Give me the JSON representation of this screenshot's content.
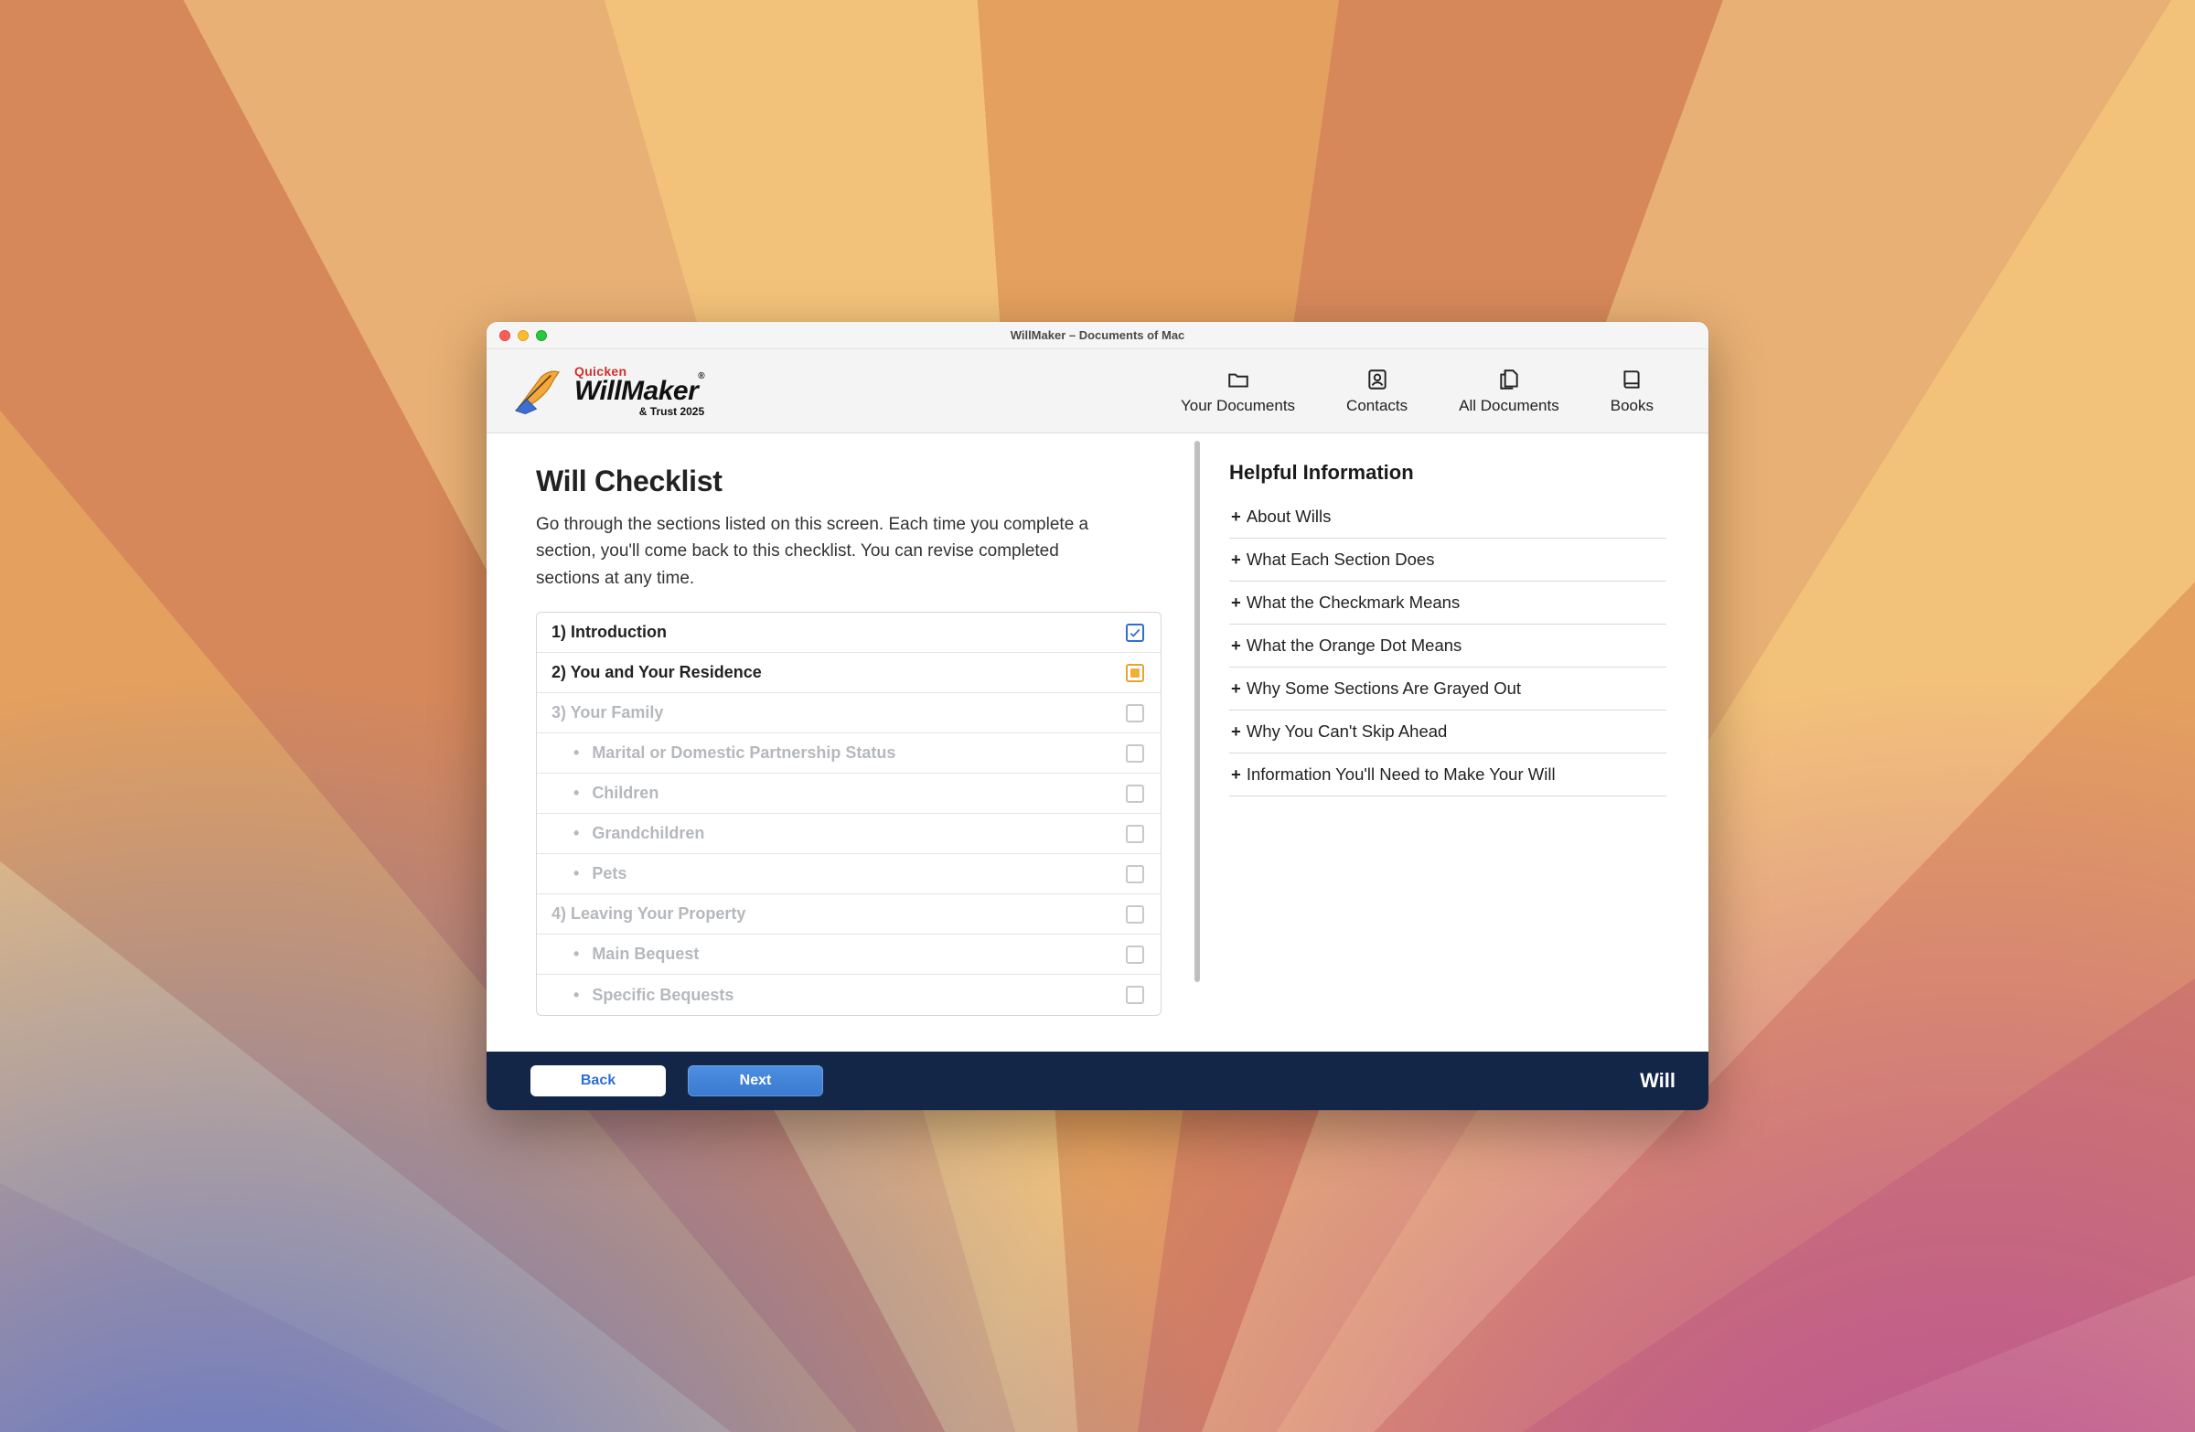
{
  "window": {
    "title": "WillMaker – Documents of Mac"
  },
  "brand": {
    "line1": "Quicken",
    "line2": "WillMaker",
    "line3": "& Trust 2025"
  },
  "nav": {
    "your_documents": "Your Documents",
    "contacts": "Contacts",
    "all_documents": "All Documents",
    "books": "Books"
  },
  "main": {
    "heading": "Will Checklist",
    "intro": "Go through the sections listed on this screen. Each time you complete a section, you'll come back to this checklist. You can revise completed sections at any time."
  },
  "checklist": [
    {
      "label": "1) Introduction",
      "status": "check",
      "indent": 0,
      "disabled": false
    },
    {
      "label": "2) You and Your Residence",
      "status": "dot",
      "indent": 0,
      "disabled": false
    },
    {
      "label": "3) Your Family",
      "status": "empty",
      "indent": 0,
      "disabled": true
    },
    {
      "label": "Marital or Domestic Partnership Status",
      "status": "empty",
      "indent": 1,
      "disabled": true
    },
    {
      "label": "Children",
      "status": "empty",
      "indent": 1,
      "disabled": true
    },
    {
      "label": "Grandchildren",
      "status": "empty",
      "indent": 1,
      "disabled": true
    },
    {
      "label": "Pets",
      "status": "empty",
      "indent": 1,
      "disabled": true
    },
    {
      "label": "4) Leaving Your Property",
      "status": "empty",
      "indent": 0,
      "disabled": true
    },
    {
      "label": "Main Bequest",
      "status": "empty",
      "indent": 1,
      "disabled": true
    },
    {
      "label": "Specific Bequests",
      "status": "empty",
      "indent": 1,
      "disabled": true
    }
  ],
  "help": {
    "heading": "Helpful Information",
    "items": [
      "About Wills",
      "What Each Section Does",
      "What the Checkmark Means",
      "What the Orange Dot Means",
      "Why Some Sections Are Grayed Out",
      "Why You Can't Skip Ahead",
      "Information You'll Need to Make Your Will"
    ]
  },
  "footer": {
    "back": "Back",
    "next": "Next",
    "doclabel": "Will"
  }
}
